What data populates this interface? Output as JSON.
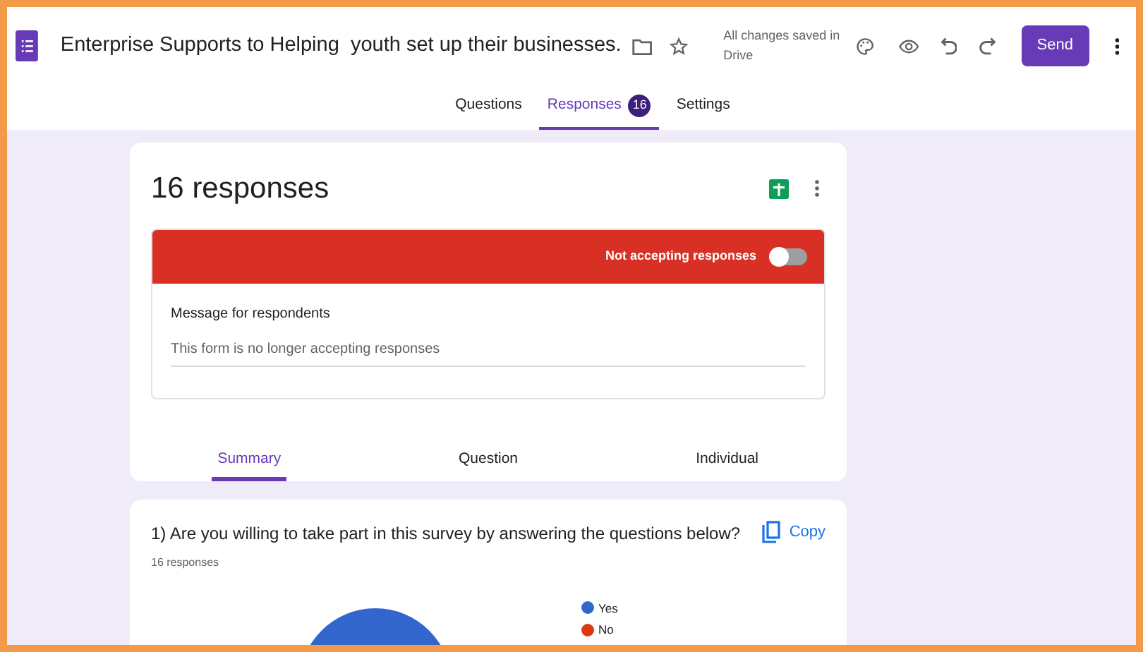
{
  "header": {
    "title": "Enterprise Supports to Helping  youth set up their businesses.",
    "save_status": "All changes saved in Drive",
    "send_button": "Send"
  },
  "tabs": [
    {
      "label": "Questions",
      "selected": false
    },
    {
      "label": "Responses",
      "badge": "16",
      "selected": true
    },
    {
      "label": "Settings",
      "selected": false
    }
  ],
  "responses_card": {
    "title": "16 responses",
    "banner": {
      "label": "Not accepting responses",
      "on": false
    },
    "message_label": "Message for respondents",
    "message_value": "This form is no longer accepting responses"
  },
  "view_tabs": [
    {
      "label": "Summary",
      "selected": true
    },
    {
      "label": "Question",
      "selected": false
    },
    {
      "label": "Individual",
      "selected": false
    }
  ],
  "question_card": {
    "question": "1) Are you willing to take part in this survey by answering the questions below?",
    "copy_button": "Copy",
    "response_count": "16 responses",
    "legend": [
      {
        "label": "Yes",
        "color": "#3366cc"
      },
      {
        "label": "No",
        "color": "#dc3912"
      }
    ]
  }
}
